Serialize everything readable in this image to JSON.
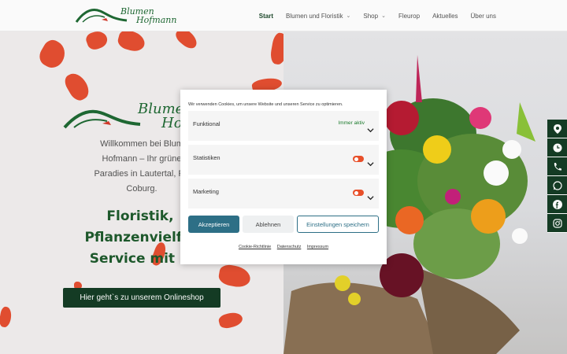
{
  "header": {
    "logo_line1": "Blumen",
    "logo_line2": "Hofmann",
    "nav": [
      {
        "label": "Start",
        "active": true,
        "has_dropdown": false
      },
      {
        "label": "Blumen und Floristik",
        "active": false,
        "has_dropdown": true
      },
      {
        "label": "Shop",
        "active": false,
        "has_dropdown": true
      },
      {
        "label": "Fleurop",
        "active": false,
        "has_dropdown": false
      },
      {
        "label": "Aktuelles",
        "active": false,
        "has_dropdown": false
      },
      {
        "label": "Über uns",
        "active": false,
        "has_dropdown": false
      }
    ]
  },
  "hero": {
    "logo_line1": "Blumen",
    "logo_line2": "Ho",
    "welcome_lines": [
      "Willkommen bei Blum",
      "Hofmann – Ihr grüne",
      "Paradies in Lautertal, Ra",
      "Coburg."
    ],
    "slogan_lines": [
      "Floristik,",
      "Pflanzenvielfal",
      "Service mit H"
    ],
    "shop_button": "Hier geht`s zu unserem Onlineshop"
  },
  "social_icons": [
    "location-icon",
    "clock-icon",
    "phone-icon",
    "whatsapp-icon",
    "facebook-icon",
    "instagram-icon"
  ],
  "cookie": {
    "message": "Wir verwenden Cookies, um unsere Website und unseren Service zu optimieren.",
    "categories": [
      {
        "label": "Funktional",
        "status": "Immer aktiv"
      },
      {
        "label": "Statistiken",
        "status": ""
      },
      {
        "label": "Marketing",
        "status": ""
      }
    ],
    "accept_label": "Akzeptieren",
    "decline_label": "Ablehnen",
    "save_label": "Einstellungen speichern",
    "links": [
      "Cookie-Richtlinie",
      "Datenschutz",
      "Impressum"
    ]
  },
  "colors": {
    "primary_green": "#153d25",
    "accent_blue": "#2d6f86",
    "toggle_orange": "#e8502a",
    "petal_red": "#e33d1c"
  }
}
